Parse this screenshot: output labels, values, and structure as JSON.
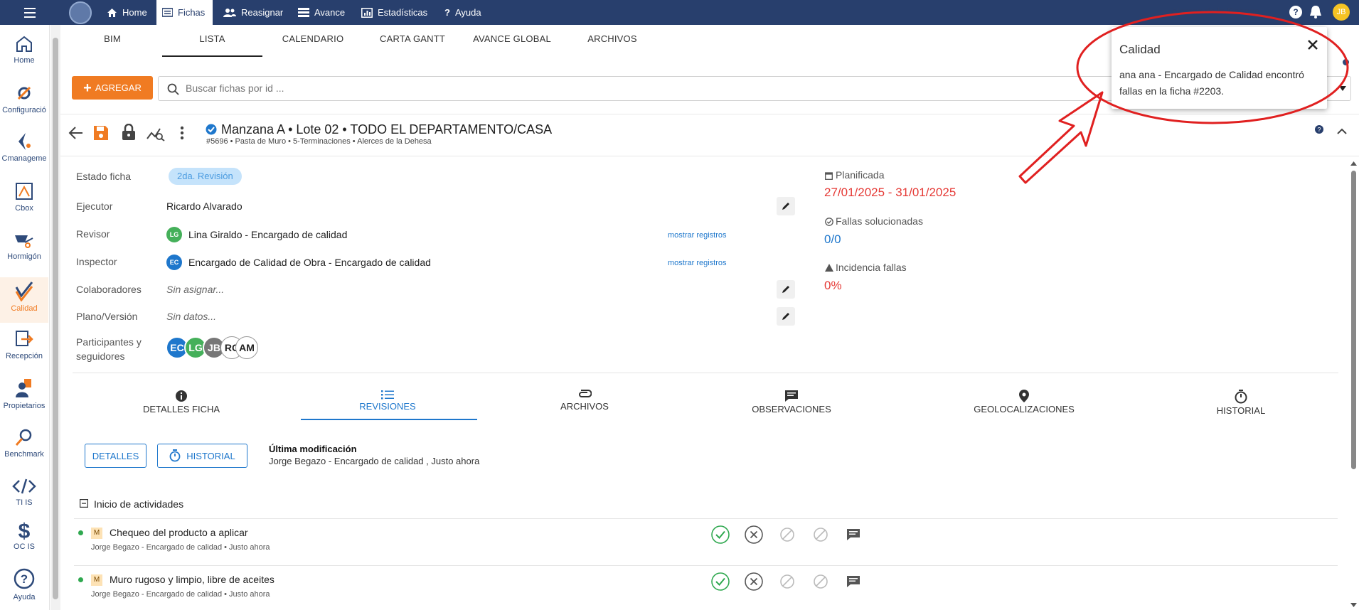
{
  "topbar": {
    "nav": [
      {
        "label": "Home",
        "icon": "home-icon"
      },
      {
        "label": "Fichas",
        "icon": "list-icon"
      },
      {
        "label": "Reasignar",
        "icon": "users-icon"
      },
      {
        "label": "Avance",
        "icon": "progress-icon"
      },
      {
        "label": "Estadísticas",
        "icon": "chart-icon"
      },
      {
        "label": "Ayuda",
        "icon": "question-icon"
      }
    ],
    "project": "Alerces de la Dehesa",
    "user_initials": "JB"
  },
  "sidebar": {
    "items": [
      {
        "label": "Home",
        "icon": "home-icon"
      },
      {
        "label": "Configuració",
        "icon": "settings-icon"
      },
      {
        "label": "Cmanageme",
        "icon": "cmanagement-icon"
      },
      {
        "label": "Cbox",
        "icon": "cbox-icon"
      },
      {
        "label": "Hormigón",
        "icon": "wheelbarrow-icon"
      },
      {
        "label": "Calidad",
        "icon": "quality-icon"
      },
      {
        "label": "Recepción",
        "icon": "reception-icon"
      },
      {
        "label": "Propietarios",
        "icon": "owners-icon"
      },
      {
        "label": "Benchmark",
        "icon": "benchmark-icon"
      },
      {
        "label": "TI IS",
        "icon": "code-icon"
      },
      {
        "label": "OC IS",
        "icon": "dollar-icon"
      },
      {
        "label": "Ayuda",
        "icon": "help-icon"
      }
    ]
  },
  "tabs": [
    "BIM",
    "LISTA",
    "CALENDARIO",
    "CARTA GANTT",
    "AVANCE GLOBAL",
    "ARCHIVOS"
  ],
  "toolbar": {
    "add_label": "AGREGAR",
    "search_placeholder": "Buscar fichas por id ..."
  },
  "ficha": {
    "title": "Manzana A • Lote 02 • TODO EL DEPARTAMENTO/CASA",
    "subtitle": "#5696 • Pasta de Muro • 5-Terminaciones • Alerces de la Dehesa"
  },
  "details": {
    "estado_label": "Estado ficha",
    "estado_value": "2da. Revisión",
    "ejecutor_label": "Ejecutor",
    "ejecutor_value": "Ricardo Alvarado",
    "revisor_label": "Revisor",
    "revisor_initials": "LG",
    "revisor_value": "Lina Giraldo - Encargado de calidad",
    "inspector_label": "Inspector",
    "inspector_initials": "EC",
    "inspector_value": "Encargado de Calidad de Obra - Encargado de calidad",
    "mostrar": "mostrar registros",
    "colab_label": "Colaboradores",
    "colab_value": "Sin asignar...",
    "plano_label": "Plano/Versión",
    "plano_value": "Sin datos...",
    "part_label_1": "Participantes y",
    "part_label_2": "seguidores",
    "participants": [
      "EC",
      "LG",
      "JB",
      "RC",
      "AM"
    ]
  },
  "stats": {
    "planificada_label": "Planificada",
    "planificada_value": "27/01/2025 - 31/01/2025",
    "fallas_label": "Fallas solucionadas",
    "fallas_value": "0/0",
    "incidencia_label": "Incidencia fallas",
    "incidencia_value": "0%"
  },
  "section_tabs": [
    "DETALLES FICHA",
    "REVISIONES",
    "ARCHIVOS",
    "OBSERVACIONES",
    "GEOLOCALIZACIONES",
    "HISTORIAL"
  ],
  "revisions": {
    "detalles_btn": "DETALLES",
    "historial_btn": "HISTORIAL",
    "last_mod_label": "Última modificación",
    "last_mod_value": "Jorge Begazo - Encargado de calidad , Justo ahora",
    "section_title": "Inicio de actividades",
    "items": [
      {
        "tag": "M",
        "title": "Chequeo del producto a aplicar",
        "meta": "Jorge Begazo - Encargado de calidad • Justo ahora"
      },
      {
        "tag": "M",
        "title": "Muro rugoso y limpio, libre de aceites",
        "meta": "Jorge Begazo - Encargado de calidad • Justo ahora"
      }
    ]
  },
  "notification": {
    "title": "Calidad",
    "body": "ana ana - Encargado de Calidad encontró fallas en la ficha #2203."
  },
  "colors": {
    "navbar": "#283f6d",
    "accent": "#f07b22",
    "link": "#1e77cc",
    "danger": "#e53935",
    "success": "#2fa84f"
  }
}
